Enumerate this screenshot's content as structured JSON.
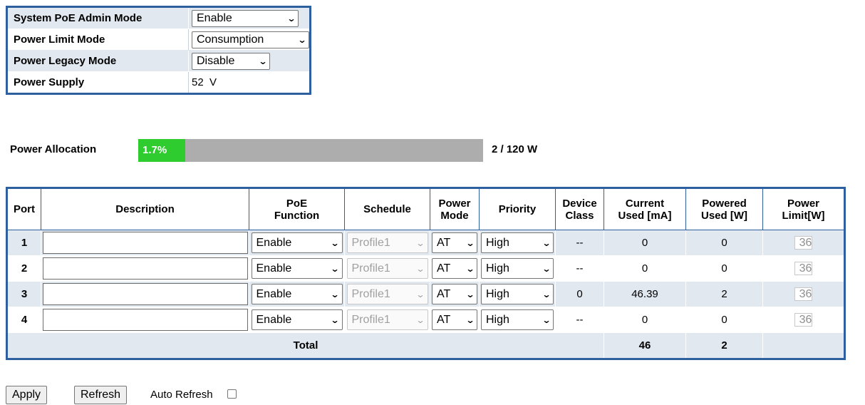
{
  "config": {
    "admin_mode": {
      "label": "System PoE Admin Mode",
      "value": "Enable"
    },
    "limit_mode": {
      "label": "Power Limit Mode",
      "value": "Consumption"
    },
    "legacy_mode": {
      "label": "Power Legacy Mode",
      "value": "Disable"
    },
    "supply": {
      "label": "Power Supply",
      "value": "52  V"
    }
  },
  "allocation": {
    "label": "Power Allocation",
    "percent_text": "1.7%",
    "fraction": 0.017,
    "total_text": "2 / 120 W"
  },
  "table": {
    "headers": {
      "port": "Port",
      "description": "Description",
      "poe_function_1": "PoE",
      "poe_function_2": "Function",
      "schedule": "Schedule",
      "power_mode_1": "Power",
      "power_mode_2": "Mode",
      "priority": "Priority",
      "device_class_1": "Device",
      "device_class_2": "Class",
      "current_1": "Current",
      "current_2": "Used [mA]",
      "powered_1": "Powered",
      "powered_2": "Used [W]",
      "limit_1": "Power",
      "limit_2": "Limit[W]"
    },
    "rows": [
      {
        "port": "1",
        "function": "Enable",
        "schedule": "Profile1",
        "mode": "AT",
        "priority": "High",
        "device_class": "--",
        "current": "0",
        "powered": "0",
        "limit": "36"
      },
      {
        "port": "2",
        "function": "Enable",
        "schedule": "Profile1",
        "mode": "AT",
        "priority": "High",
        "device_class": "--",
        "current": "0",
        "powered": "0",
        "limit": "36"
      },
      {
        "port": "3",
        "function": "Enable",
        "schedule": "Profile1",
        "mode": "AT",
        "priority": "High",
        "device_class": "0",
        "current": "46.39",
        "powered": "2",
        "limit": "36"
      },
      {
        "port": "4",
        "function": "Enable",
        "schedule": "Profile1",
        "mode": "AT",
        "priority": "High",
        "device_class": "--",
        "current": "0",
        "powered": "0",
        "limit": "36"
      }
    ],
    "total": {
      "label": "Total",
      "current": "46",
      "powered": "2"
    }
  },
  "buttons": {
    "apply": "Apply",
    "refresh": "Refresh",
    "auto_refresh": "Auto Refresh"
  },
  "colors": {
    "border": "#2e5f9e",
    "row_shade": "#e1e8f0",
    "bar_fill": "#2ecc2e",
    "bar_bg": "#adadad"
  }
}
